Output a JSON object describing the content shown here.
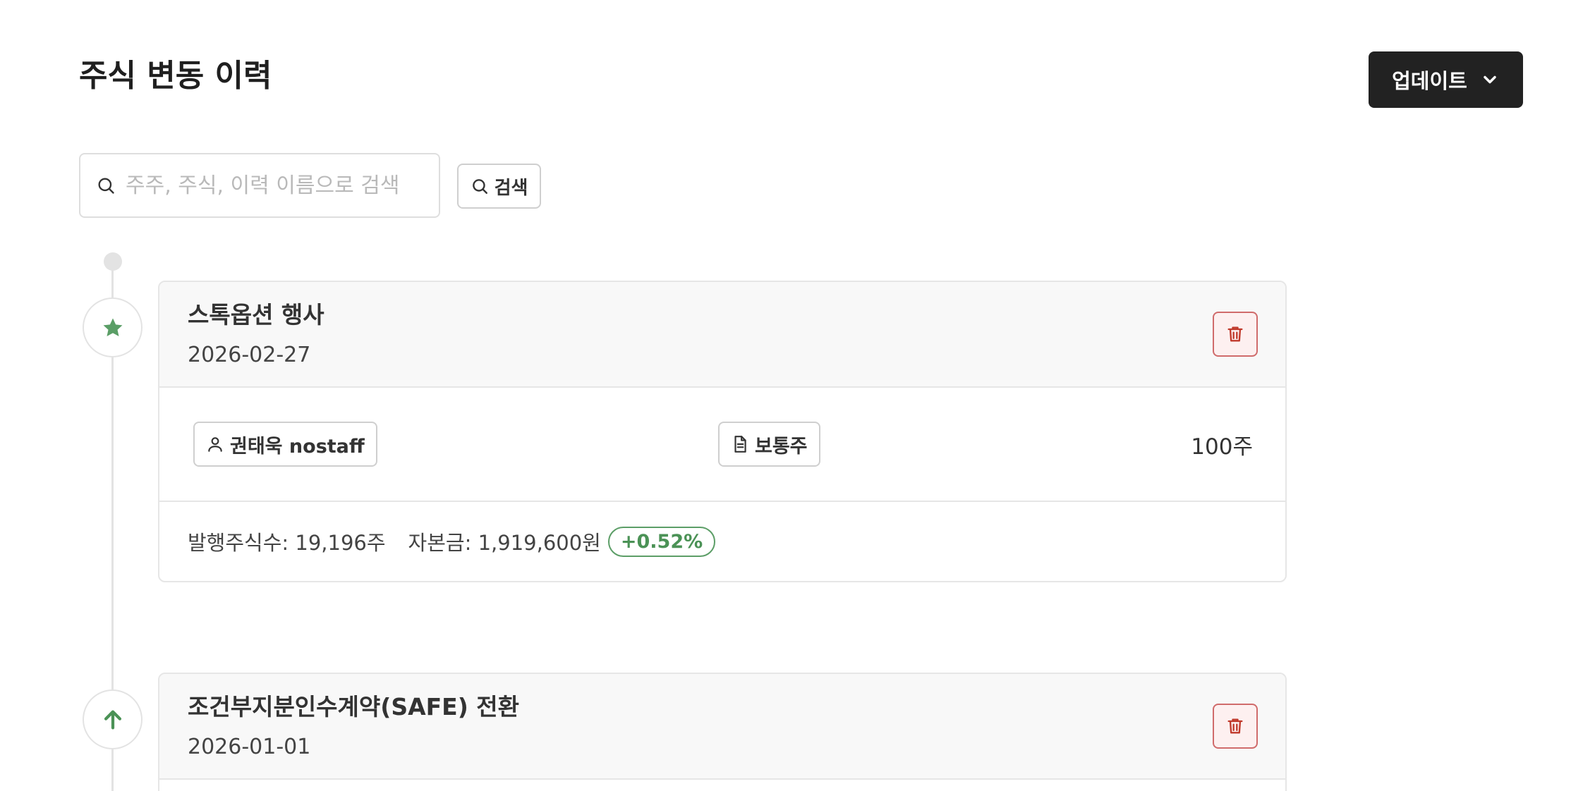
{
  "header": {
    "title": "주식 변동 이력",
    "update_label": "업데이트"
  },
  "search": {
    "placeholder": "주주, 주식, 이력 이름으로 검색",
    "value": "",
    "button_label": "검색"
  },
  "events": [
    {
      "title": "스톡옵션 행사",
      "date": "2026-02-27",
      "marker_icon": "star-icon",
      "holder": "권태욱 nostaff",
      "stock_class": "보통주",
      "quantity": "100주",
      "issued_shares": "발행주식수: 19,196주",
      "capital": "자본금: 1,919,600원",
      "change": "+0.52%"
    },
    {
      "title": "조건부지분인수계약(SAFE) 전환",
      "date": "2026-01-01",
      "marker_icon": "arrow-up-icon"
    }
  ],
  "colors": {
    "accent_green": "#4b9256",
    "danger_red": "#c0392b",
    "dark_button": "#222222"
  }
}
